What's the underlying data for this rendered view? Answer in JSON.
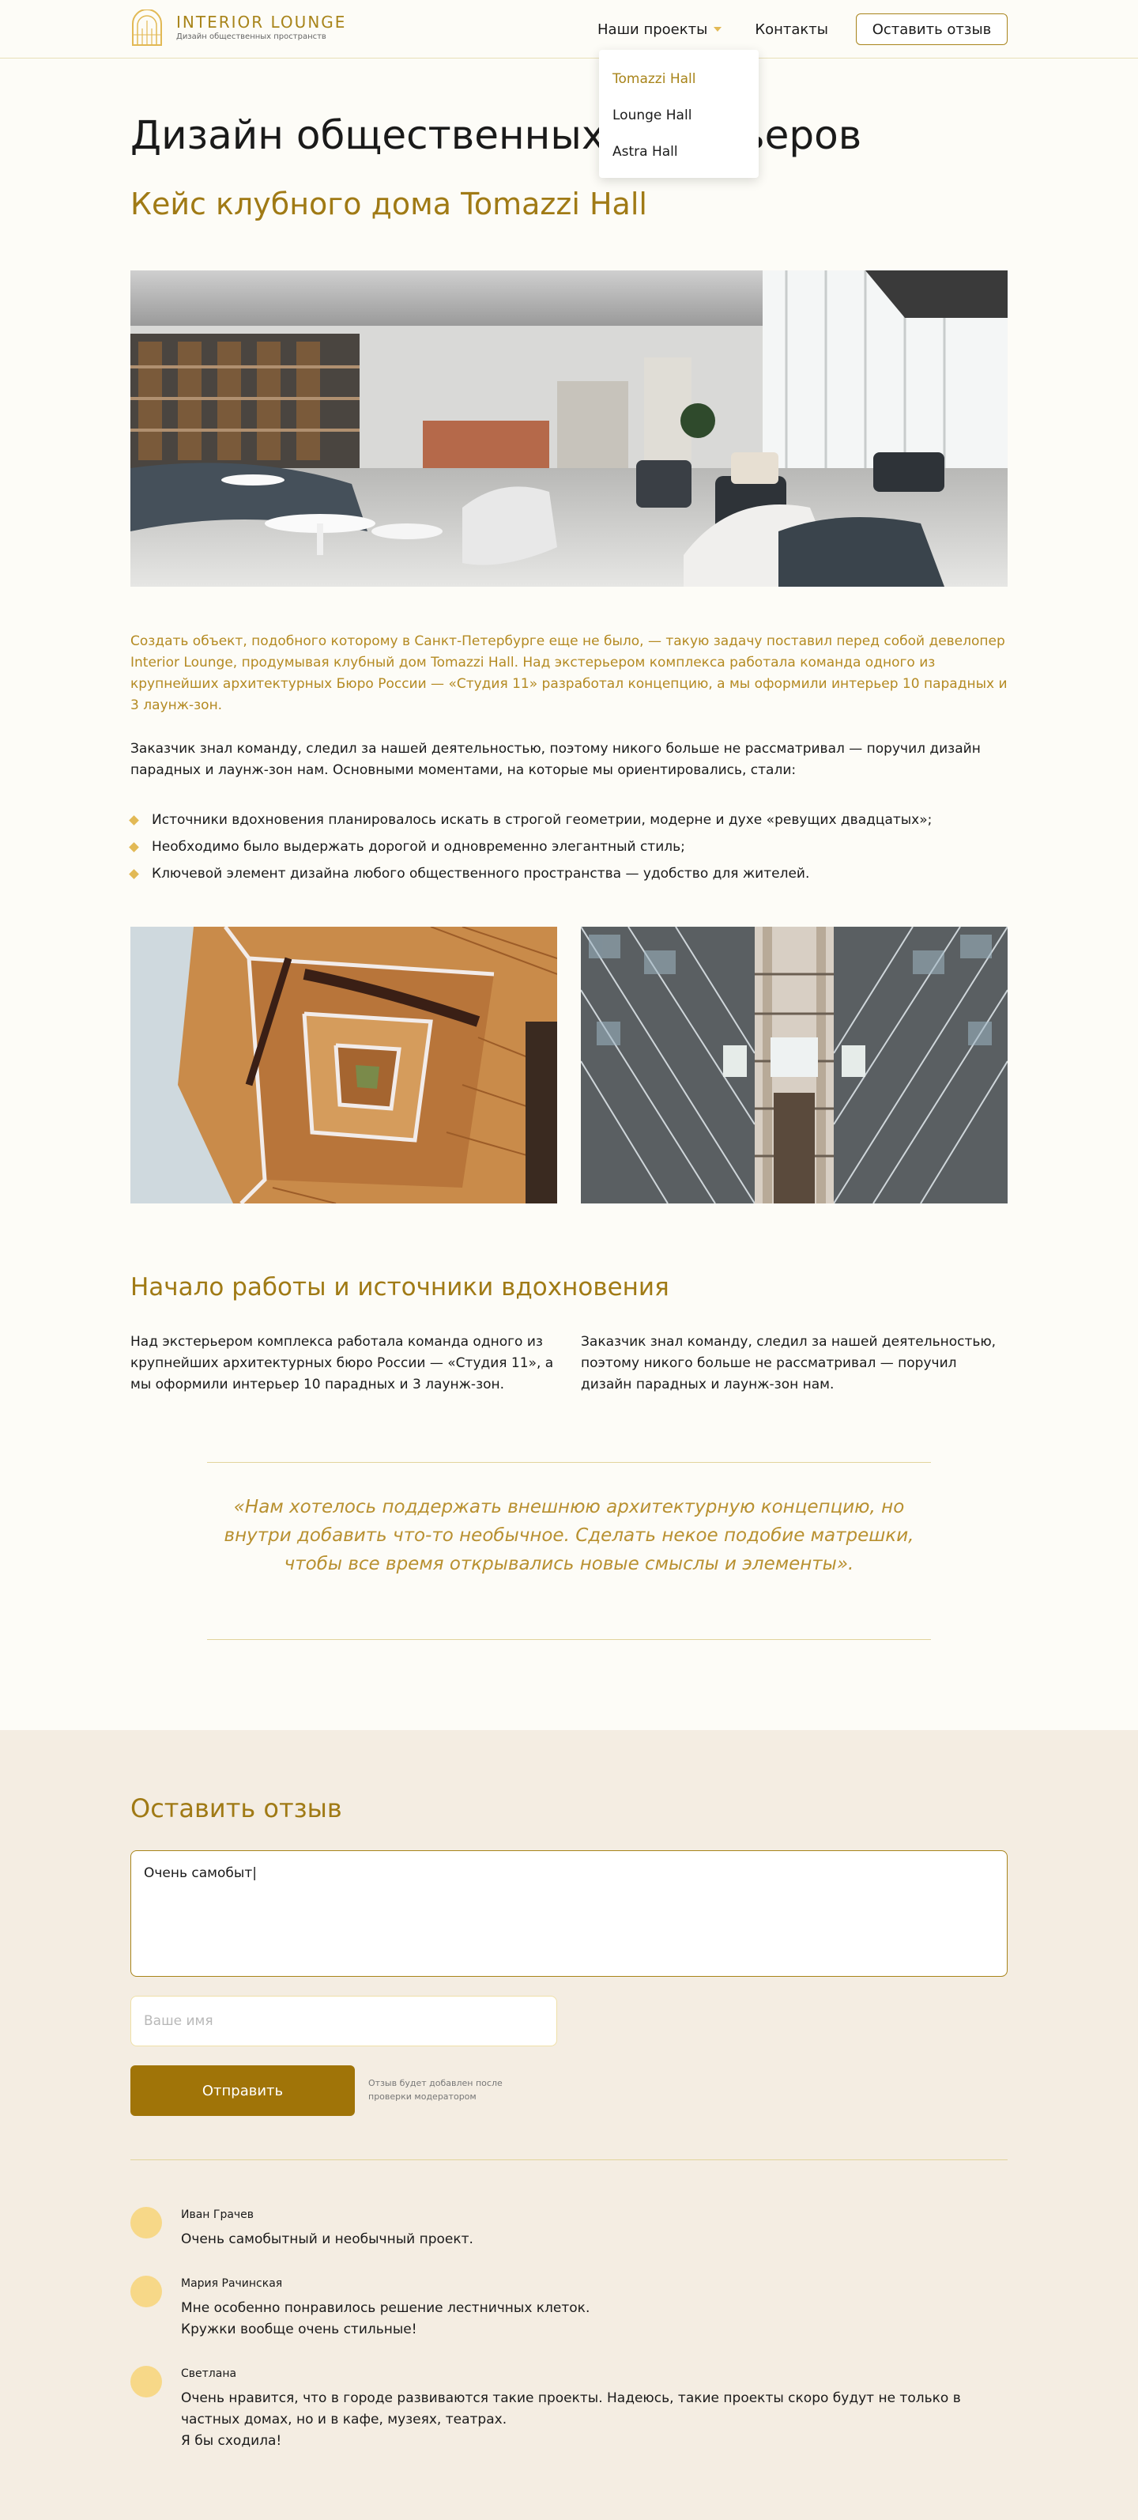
{
  "header": {
    "logo_title": "INTERIOR LOUNGE",
    "logo_subtitle": "Дизайн общественных пространств",
    "nav": {
      "projects": "Наши проекты",
      "contacts": "Контакты"
    },
    "review_button": "Оставить отзыв",
    "dropdown": [
      "Tomazzi Hall",
      "Lounge Hall",
      "Astra Hall"
    ],
    "accent_color": "#a8841a"
  },
  "article": {
    "title": "Дизайн общественных интерьеров",
    "subtitle": "Кейс клубного дома Tomazzi Hall",
    "lead": "Создать объект, подобного которому в Санкт-Петербурге еще не было, — такую задачу поставил перед собой девелопер Interior Lounge, продумывая клубный дом Tomazzi Hall. Над экстерьером комплекса работала команда одного из крупнейших архитектурных  Бюро России — «Студия 11» разработал концепцию, а мы оформили интерьер 10 парадных и 3 лаунж-зон.",
    "paragraph": "Заказчик знал команду, следил за нашей деятельностью, поэтому никого больше не рассматривал — поручил дизайн парадных и лаунж-зон нам. Основными моментами, на которые мы ориентировались, стали:",
    "bullets": [
      "Источники вдохновения планировалось искать в строгой геометрии, модерне и духе «ревущих двадцатых»;",
      "Необходимо было выдержать дорогой и одновременно элегантный стиль;",
      "Ключевой элемент дизайна любого общественного пространства — удобство для жителей."
    ],
    "section_title": "Начало работы и источники вдохновения",
    "col_left": "Над экстерьером комплекса работала команда одного из крупнейших архитектурных бюро России — «Студия 11», а мы оформили интерьер 10 парадных и 3 лаунж-зон.",
    "col_right": "Заказчик знал команду, следил за нашей деятельностью, поэтому никого больше не рассматривал — поручил дизайн парадных и лаунж-зон нам.",
    "quote": "«Нам хотелось поддержать внешнюю архитектурную концепцию, но внутри добавить что-то необычное. Сделать некое подобие матрешки, чтобы все время открывались новые смыслы и элементы»."
  },
  "review_form": {
    "title": "Оставить отзыв",
    "textarea_value": "Очень самобыт|",
    "name_placeholder": "Ваше имя",
    "submit_label": "Отправить",
    "note": "Отзыв будет добавлен после проверки модератором"
  },
  "comments": [
    {
      "name": "Иван Грачев",
      "text": "Очень самобытный и необычный проект."
    },
    {
      "name": "Мария Рачинская",
      "text": "Мне особенно понравилось решение лестничных клеток.\nКружки вообще очень стильные!"
    },
    {
      "name": "Светлана",
      "text": "Очень нравится, что в городе развиваются такие проекты. Надеюсь, такие проекты скоро будут не только в частных домах, но и в кафе, музеях, театрах.\nЯ бы сходила!"
    }
  ]
}
